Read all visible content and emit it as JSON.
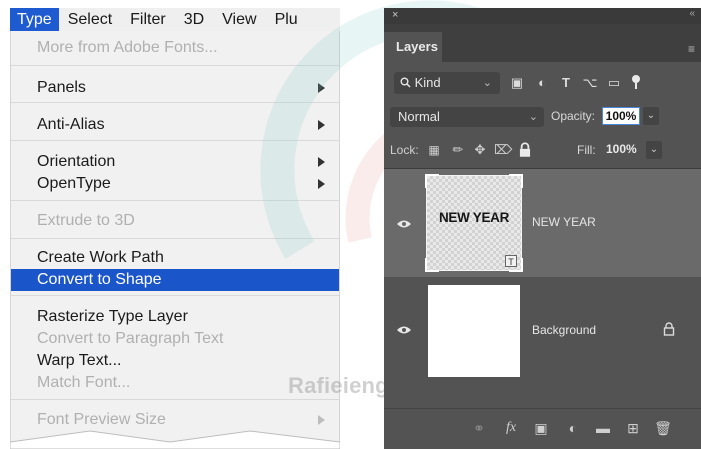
{
  "menu_bar": {
    "items": [
      "Type",
      "Select",
      "Filter",
      "3D",
      "View",
      "Plu"
    ],
    "active_index": 0
  },
  "type_menu": {
    "more_fonts": "More from Adobe Fonts...",
    "panels": "Panels",
    "anti_alias": "Anti-Alias",
    "orientation": "Orientation",
    "opentype": "OpenType",
    "extrude": "Extrude to 3D",
    "create_work_path": "Create Work Path",
    "convert_to_shape": "Convert to Shape",
    "rasterize": "Rasterize Type Layer",
    "convert_paragraph": "Convert to Paragraph Text",
    "warp_text": "Warp Text...",
    "match_font": "Match Font...",
    "font_preview": "Font Preview Size"
  },
  "watermark": "Rafieienglishclinic.com",
  "layers_panel": {
    "close": "×",
    "collapse": "«",
    "title": "Layers",
    "menu_icon": "≡",
    "kind_label": "Kind",
    "blend_mode": "Normal",
    "opacity_label": "Opacity:",
    "opacity_value": "100%",
    "lock_label": "Lock:",
    "fill_label": "Fill:",
    "fill_value": "100%",
    "layers": [
      {
        "name": "NEW YEAR",
        "thumb_text": "NEW YEAR",
        "selected": true
      },
      {
        "name": "Background",
        "selected": false,
        "locked": true
      }
    ]
  },
  "icons": {
    "filter": [
      "pixel-filter-icon",
      "adjustment-filter-icon",
      "type-filter-icon",
      "shape-filter-icon",
      "smart-object-filter-icon",
      "filter-toggle-icon"
    ],
    "lock": [
      "lock-transparent-icon",
      "lock-pixels-icon",
      "lock-position-icon",
      "lock-artboard-icon",
      "lock-all-icon"
    ],
    "bottom": [
      "link-layers-icon",
      "fx-icon",
      "mask-icon",
      "adjustment-layer-icon",
      "group-folder-icon",
      "new-layer-icon",
      "trash-icon"
    ]
  },
  "colors": {
    "menu_highlight": "#1a55c9",
    "panel_bg": "#535353",
    "selected_layer": "#6a6a6a"
  }
}
